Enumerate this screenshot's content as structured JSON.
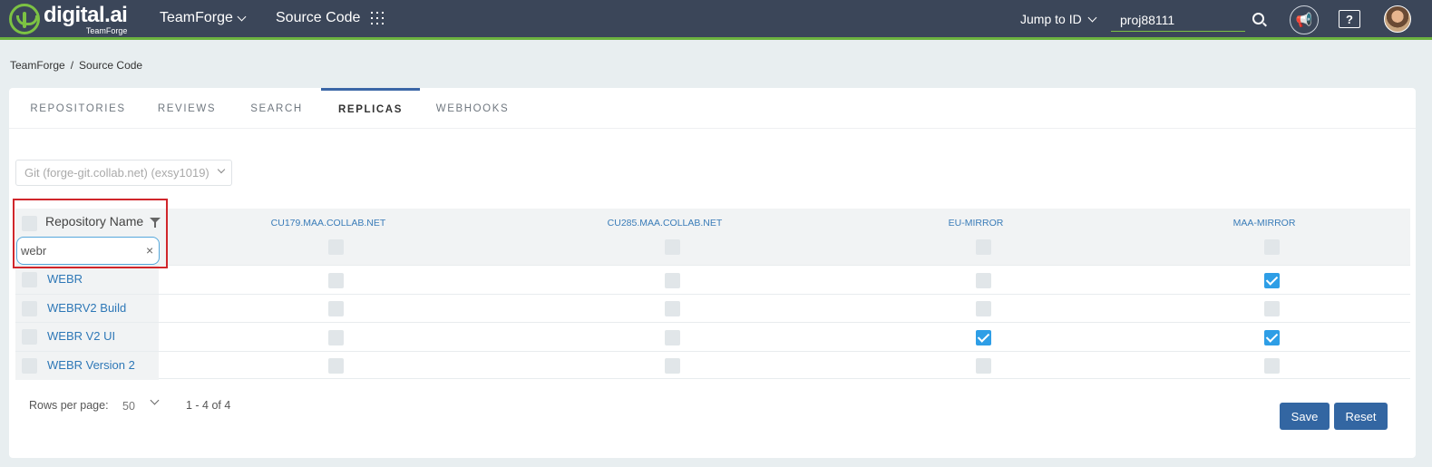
{
  "header": {
    "logo_brand": "digital.ai",
    "logo_sub": "TeamForge",
    "nav_teamforge": "TeamForge",
    "nav_source_code": "Source Code",
    "jump_to_id": "Jump to ID",
    "project_value": "proj88111",
    "icons": [
      "grid-icon",
      "search-icon",
      "megaphone-icon",
      "help-icon",
      "avatar"
    ]
  },
  "breadcrumb": {
    "item1": "TeamForge",
    "separator": "/",
    "item2": "Source Code"
  },
  "tabs": [
    {
      "label": "REPOSITORIES",
      "active": false
    },
    {
      "label": "REVIEWS",
      "active": false
    },
    {
      "label": "SEARCH",
      "active": false
    },
    {
      "label": "REPLICAS",
      "active": true
    },
    {
      "label": "WEBHOOKS",
      "active": false
    }
  ],
  "repo_select": {
    "value": "Git (forge-git.collab.net) (exsy1019)"
  },
  "table": {
    "first_column": "Repository Name",
    "filter_value": "webr",
    "clear_icon": "×",
    "columns": [
      "CU179.MAA.COLLAB.NET",
      "CU285.MAA.COLLAB.NET",
      "EU-MIRROR",
      "MAA-MIRROR"
    ],
    "rows": [
      {
        "name": "WEBR",
        "checks": [
          false,
          false,
          false,
          true
        ]
      },
      {
        "name": "WEBRV2 Build",
        "checks": [
          false,
          false,
          false,
          false
        ]
      },
      {
        "name": "WEBR V2 UI",
        "checks": [
          false,
          false,
          true,
          true
        ]
      },
      {
        "name": "WEBR Version 2",
        "checks": [
          false,
          false,
          false,
          false
        ]
      }
    ]
  },
  "footer": {
    "rows_per_page_label": "Rows per page:",
    "rows_per_page_value": "50",
    "range": "1 - 4 of 4",
    "save_label": "Save",
    "reset_label": "Reset"
  },
  "colors": {
    "topbar": "#3b4659",
    "accent_green": "#7cc243",
    "link_blue": "#2e78b7",
    "button_blue": "#3366a2",
    "checkbox_checked": "#2e9ee6",
    "highlight_red": "#d0262b"
  }
}
